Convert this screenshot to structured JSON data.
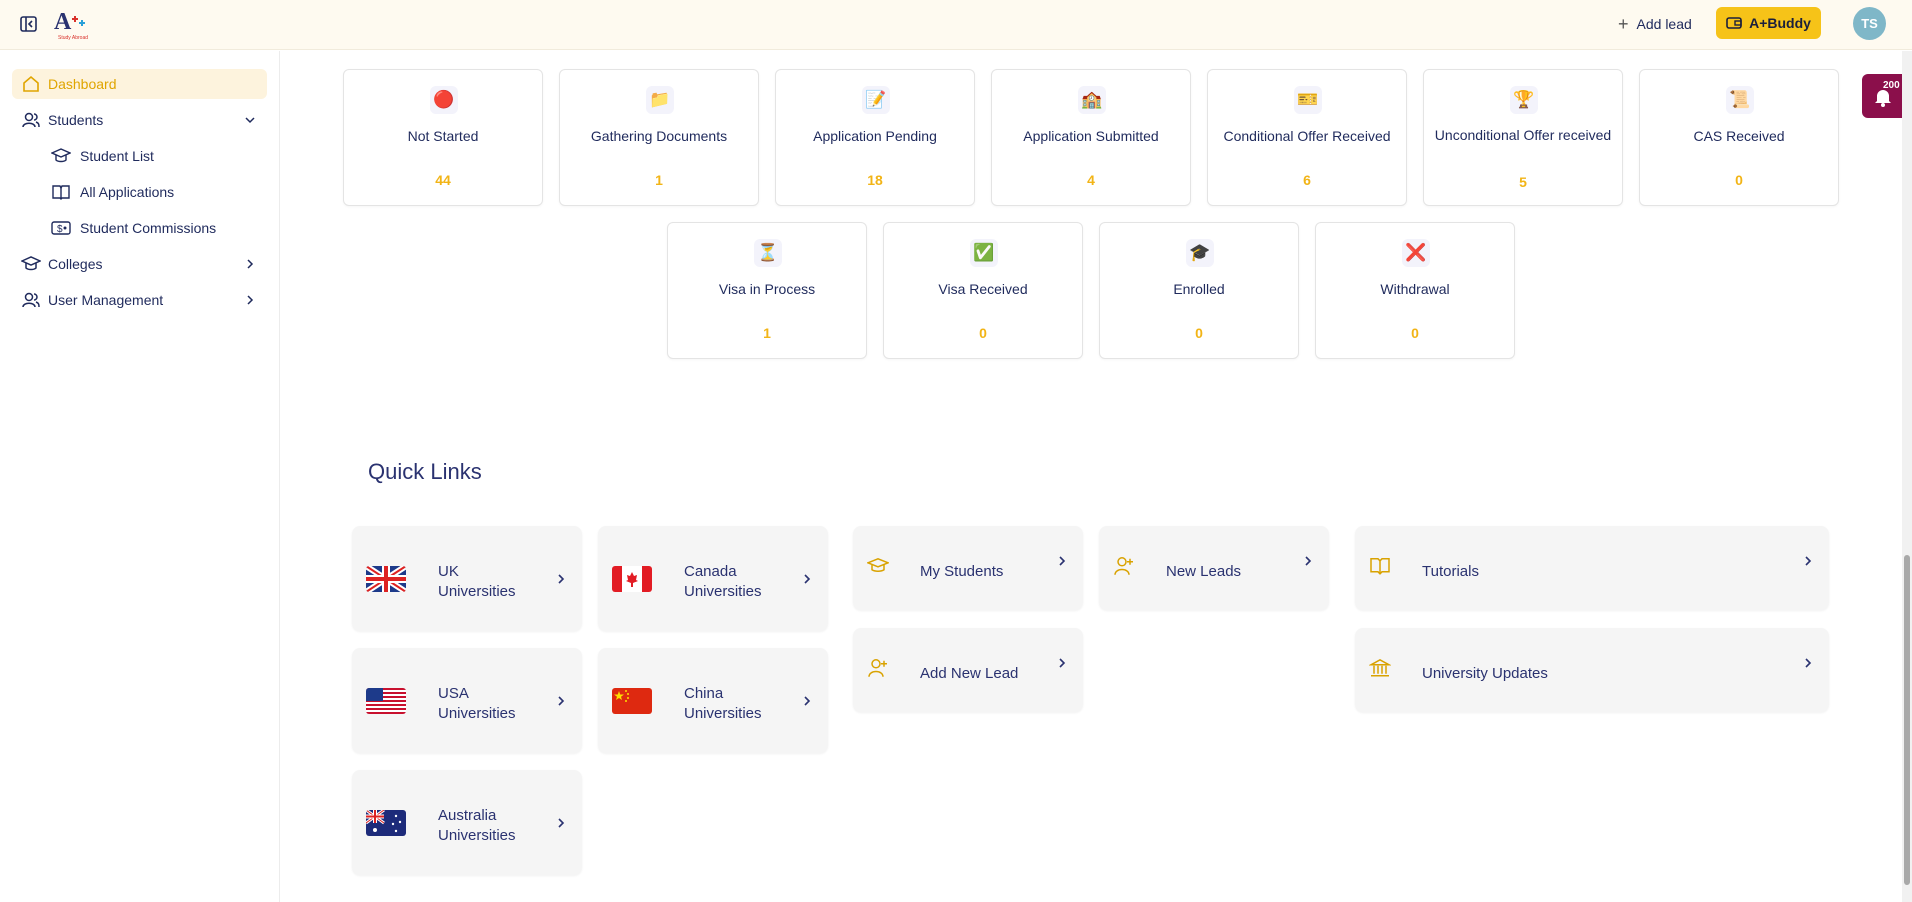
{
  "header": {
    "add_lead_label": "Add lead",
    "abuddy_label": "A+Buddy",
    "avatar_initials": "TS"
  },
  "sidebar": {
    "items": [
      {
        "label": "Dashboard",
        "icon": "home-icon",
        "active": true
      },
      {
        "label": "Students",
        "icon": "users-icon"
      },
      {
        "label": "Colleges",
        "icon": "graduation-cap-icon"
      },
      {
        "label": "User Management",
        "icon": "user-group-icon"
      }
    ],
    "sub_items": [
      {
        "label": "Student List",
        "icon": "graduation-cap-icon"
      },
      {
        "label": "All Applications",
        "icon": "book-open-icon"
      },
      {
        "label": "Student Commissions",
        "icon": "money-icon"
      }
    ]
  },
  "status_cards": [
    {
      "label": "Not Started",
      "count": "44",
      "icon": "🔴"
    },
    {
      "label": "Gathering Documents",
      "count": "1",
      "icon": "📁"
    },
    {
      "label": "Application Pending",
      "count": "18",
      "icon": "📝"
    },
    {
      "label": "Application Submitted",
      "count": "4",
      "icon": "🏫"
    },
    {
      "label": "Conditional Offer Received",
      "count": "6",
      "icon": "🎫"
    },
    {
      "label": "Unconditional Offer received",
      "count": "5",
      "icon": "🏆"
    },
    {
      "label": "CAS Received",
      "count": "0",
      "icon": "📜"
    },
    {
      "label": "Visa in Process",
      "count": "1",
      "icon": "⏳"
    },
    {
      "label": "Visa Received",
      "count": "0",
      "icon": "✅"
    },
    {
      "label": "Enrolled",
      "count": "0",
      "icon": "🎓"
    },
    {
      "label": "Withdrawal",
      "count": "0",
      "icon": "❌"
    }
  ],
  "quick_links": {
    "title": "Quick Links",
    "universities": [
      {
        "line1": "UK",
        "line2": "Universities",
        "flag": "uk"
      },
      {
        "line1": "Canada",
        "line2": "Universities",
        "flag": "canada"
      },
      {
        "line1": "USA",
        "line2": "Universities",
        "flag": "usa"
      },
      {
        "line1": "China",
        "line2": "Universities",
        "flag": "china"
      },
      {
        "line1": "Australia",
        "line2": "Universities",
        "flag": "australia"
      }
    ],
    "my_students": "My Students",
    "new_leads": "New Leads",
    "add_new_lead": "Add New Lead",
    "tutorials": "Tutorials",
    "university_updates": "University Updates"
  },
  "notification": {
    "count": "200"
  },
  "colors": {
    "accent": "#f6c318",
    "text": "#1f2a5c",
    "count": "#f2b416"
  }
}
